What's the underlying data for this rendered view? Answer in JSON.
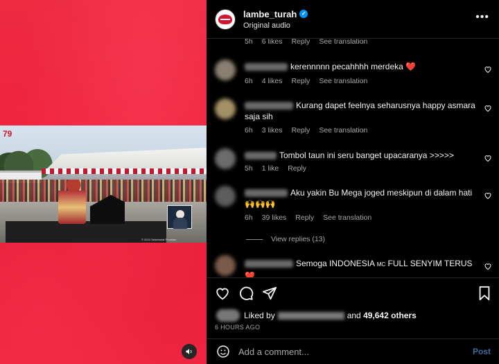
{
  "header": {
    "username": "lambe_turah",
    "subtitle": "Original audio",
    "more_icon": "more-horizontal-icon",
    "verified_icon": "verified-badge-icon"
  },
  "video": {
    "logo_text": "79",
    "caption": "© 2024 Sekretariat Presiden"
  },
  "comments": [
    {
      "text": "",
      "meta": [
        "5h",
        "6 likes",
        "Reply",
        "See translation"
      ]
    },
    {
      "text": "kerennnnn pecahhhh merdeka",
      "emoji": "❤️",
      "meta": [
        "6h",
        "4 likes",
        "Reply",
        "See translation"
      ]
    },
    {
      "text": "Kurang dapet feelnya seharusnya happy asmara saja sih",
      "meta": [
        "6h",
        "3 likes",
        "Reply",
        "See translation"
      ]
    },
    {
      "text": "Tombol taun ini seru banget upacaranya >>>>>",
      "meta": [
        "5h",
        "1 like",
        "Reply"
      ]
    },
    {
      "text": "Aku yakin Bu Mega joged meskipun di dalam hati",
      "emoji": "🙌🙌🙌",
      "meta": [
        "6h",
        "39 likes",
        "Reply",
        "See translation"
      ]
    },
    {
      "text": "Semoga INDONESIA ",
      "sup": "MC",
      "text2": " FULL SENYIM TERUS",
      "emoji": "❤️"
    }
  ],
  "view_replies": "View replies (13)",
  "likes": {
    "prefix": "Liked by",
    "middle": "and",
    "count": "49,642 others"
  },
  "time_ago": "6 HOURS AGO",
  "add_comment": {
    "placeholder": "Add a comment...",
    "post_label": "Post"
  },
  "colors": {
    "background": "#000000",
    "media_red": "#ec2a40",
    "link_blue": "#0095f6",
    "heart_red": "#ed4956",
    "muted_text": "#a8a8a8"
  }
}
